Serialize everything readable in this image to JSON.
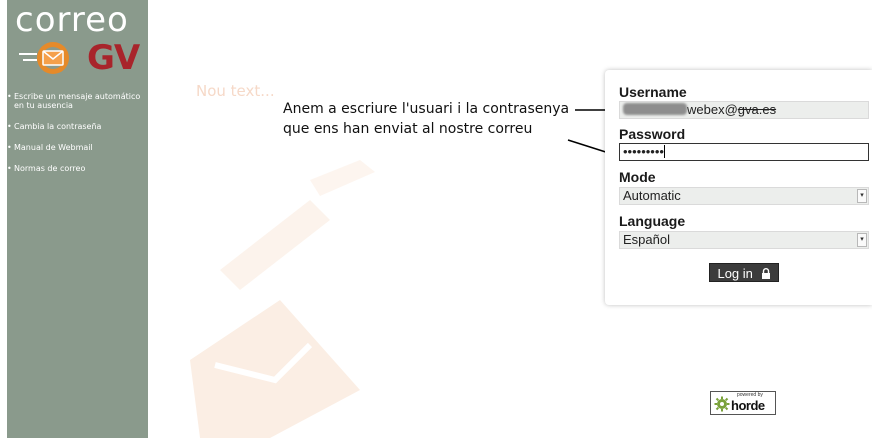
{
  "sidebar": {
    "logo_top": "correo",
    "logo_bottom": "GV",
    "links": [
      {
        "line1": "Escribe un mensaje automático",
        "line2": "en tu ausencia"
      },
      {
        "line1": "Cambia la contraseña",
        "line2": ""
      },
      {
        "line1": "Manual de Webmail",
        "line2": ""
      },
      {
        "line1": "Normas de correo",
        "line2": ""
      }
    ]
  },
  "placeholder_text": "Nou text...",
  "annotation": {
    "line1": "Anem a escriure l'usuari i la contrasenya",
    "line2": "que ens han enviat al nostre correu"
  },
  "login": {
    "username_label": "Username",
    "username_value_suffix": "webex@",
    "username_value_domain": "gva.es",
    "password_label": "Password",
    "password_value": "•••••••••",
    "mode_label": "Mode",
    "mode_value": "Automatic",
    "language_label": "Language",
    "language_value": "Español",
    "login_button": "Log in"
  },
  "footer": {
    "powered_by": "powered by",
    "brand": "horde"
  },
  "colors": {
    "sidebar_bg": "#8a9a8c",
    "brand_red": "#a8242b",
    "watermark": "#fbeee4"
  }
}
